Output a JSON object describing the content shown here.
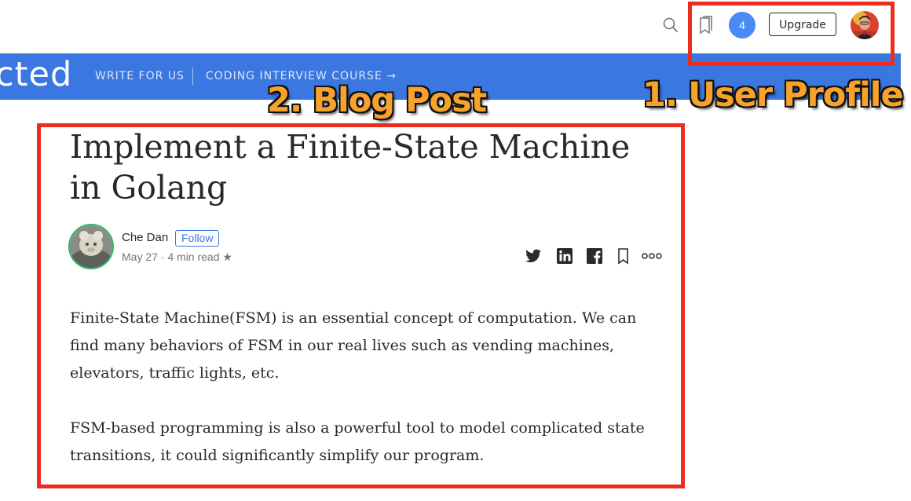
{
  "topbar": {
    "icons": [
      "search-icon",
      "bookmarks-icon"
    ],
    "notification_count": "4",
    "upgrade_label": "Upgrade"
  },
  "publication": {
    "logo_text": "cted",
    "nav": [
      {
        "label": "WRITE FOR US"
      },
      {
        "label": "CODING INTERVIEW COURSE →"
      }
    ]
  },
  "annotations": {
    "user_profile_label": "1. User Profile",
    "blog_post_label": "2. Blog Post",
    "color": "#ee2b1f",
    "label_color": "#f7a22c"
  },
  "article": {
    "title": "Implement a Finite-State Machine in Golang",
    "author": "Che Dan",
    "follow_label": "Follow",
    "meta": "May 27 · 4 min read ★",
    "share_icons": [
      "twitter-icon",
      "linkedin-icon",
      "facebook-icon",
      "bookmark-icon",
      "more-icon"
    ],
    "paragraphs": [
      "Finite-State Machine(FSM) is an essential concept of computation. We can find many behaviors of FSM in our real lives such as vending machines, elevators, traffic lights, etc.",
      "FSM-based programming is also a powerful tool to model complicated state transitions, it could significantly simplify our program."
    ]
  },
  "colors": {
    "nav_bar": "#3b77e0",
    "badge": "#4a8af4",
    "follow": "#3b77e0"
  }
}
